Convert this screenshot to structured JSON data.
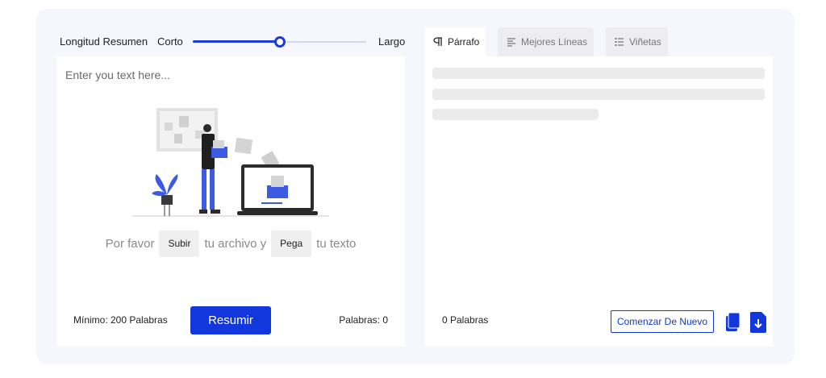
{
  "slider": {
    "title": "Longitud Resumen",
    "min_label": "Corto",
    "max_label": "Largo",
    "value": 0.5
  },
  "input": {
    "placeholder": "Enter you text here...",
    "prompt_before": "Por favor",
    "upload_label": "Subir",
    "prompt_middle": "tu archivo y",
    "paste_label": "Pega",
    "prompt_after": "tu texto",
    "min_words": "Mínimo: 200 Palabras",
    "summarize_label": "Resumir",
    "word_count": "Palabras: 0"
  },
  "tabs": [
    {
      "label": "Párrafo",
      "icon": "pilcrow-icon",
      "active": true
    },
    {
      "label": "Mejores Líneas",
      "icon": "lines-icon",
      "active": false
    },
    {
      "label": "Viñetas",
      "icon": "bullet-list-icon",
      "active": false
    }
  ],
  "output": {
    "word_count": "0 Palabras",
    "restart_label": "Comenzar De Nuevo",
    "copy_icon": "copy-icon",
    "download_icon": "download-icon"
  },
  "colors": {
    "accent": "#1237dc",
    "background": "#f6f6fd",
    "skeleton": "#ebebeb"
  }
}
